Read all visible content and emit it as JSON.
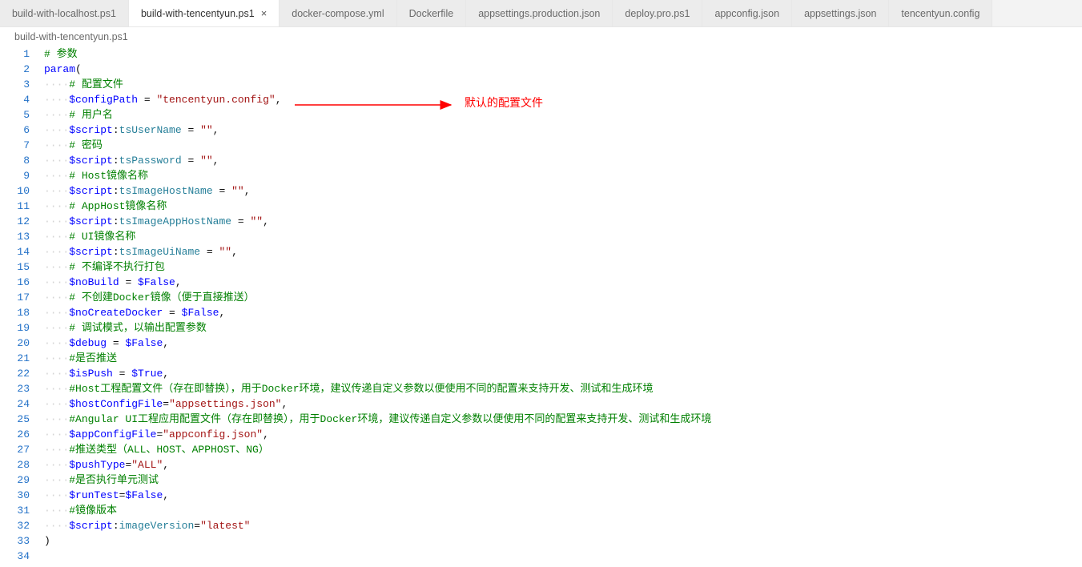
{
  "tabs": [
    {
      "label": "build-with-localhost.ps1",
      "active": false
    },
    {
      "label": "build-with-tencentyun.ps1",
      "active": true
    },
    {
      "label": "docker-compose.yml",
      "active": false
    },
    {
      "label": "Dockerfile",
      "active": false
    },
    {
      "label": "appsettings.production.json",
      "active": false
    },
    {
      "label": "deploy.pro.ps1",
      "active": false
    },
    {
      "label": "appconfig.json",
      "active": false
    },
    {
      "label": "appsettings.json",
      "active": false
    },
    {
      "label": "tencentyun.config",
      "active": false
    }
  ],
  "breadcrumb": "build-with-tencentyun.ps1",
  "annotation": "默认的配置文件",
  "close_glyph": "×",
  "lines": [
    {
      "n": 1,
      "segs": [
        {
          "t": "# 参数",
          "c": "cm-green"
        }
      ]
    },
    {
      "n": 2,
      "segs": [
        {
          "t": "param",
          "c": "cm-blue"
        },
        {
          "t": "(",
          "c": "cm-black"
        }
      ]
    },
    {
      "n": 3,
      "indent": 1,
      "segs": [
        {
          "t": "# 配置文件",
          "c": "cm-green"
        }
      ]
    },
    {
      "n": 4,
      "indent": 1,
      "segs": [
        {
          "t": "$configPath",
          "c": "cm-blue"
        },
        {
          "t": " = ",
          "c": "cm-black"
        },
        {
          "t": "\"tencentyun.config\"",
          "c": "cm-darkred"
        },
        {
          "t": ",",
          "c": "cm-black"
        }
      ]
    },
    {
      "n": 5,
      "indent": 1,
      "segs": [
        {
          "t": "# 用户名",
          "c": "cm-green"
        }
      ]
    },
    {
      "n": 6,
      "indent": 1,
      "segs": [
        {
          "t": "$script",
          "c": "cm-blue"
        },
        {
          "t": ":",
          "c": "cm-black"
        },
        {
          "t": "tsUserName",
          "c": "cm-type"
        },
        {
          "t": " = ",
          "c": "cm-black"
        },
        {
          "t": "\"\"",
          "c": "cm-darkred"
        },
        {
          "t": ",",
          "c": "cm-black"
        }
      ]
    },
    {
      "n": 7,
      "indent": 1,
      "segs": [
        {
          "t": "# 密码",
          "c": "cm-green"
        }
      ]
    },
    {
      "n": 8,
      "indent": 1,
      "segs": [
        {
          "t": "$script",
          "c": "cm-blue"
        },
        {
          "t": ":",
          "c": "cm-black"
        },
        {
          "t": "tsPassword",
          "c": "cm-type"
        },
        {
          "t": " = ",
          "c": "cm-black"
        },
        {
          "t": "\"\"",
          "c": "cm-darkred"
        },
        {
          "t": ",",
          "c": "cm-black"
        }
      ]
    },
    {
      "n": 9,
      "indent": 1,
      "segs": [
        {
          "t": "# Host镜像名称",
          "c": "cm-green"
        }
      ]
    },
    {
      "n": 10,
      "indent": 1,
      "segs": [
        {
          "t": "$script",
          "c": "cm-blue"
        },
        {
          "t": ":",
          "c": "cm-black"
        },
        {
          "t": "tsImageHostName",
          "c": "cm-type"
        },
        {
          "t": " = ",
          "c": "cm-black"
        },
        {
          "t": "\"\"",
          "c": "cm-darkred"
        },
        {
          "t": ",",
          "c": "cm-black"
        }
      ]
    },
    {
      "n": 11,
      "indent": 1,
      "segs": [
        {
          "t": "# AppHost镜像名称",
          "c": "cm-green"
        }
      ]
    },
    {
      "n": 12,
      "indent": 1,
      "segs": [
        {
          "t": "$script",
          "c": "cm-blue"
        },
        {
          "t": ":",
          "c": "cm-black"
        },
        {
          "t": "tsImageAppHostName",
          "c": "cm-type"
        },
        {
          "t": " = ",
          "c": "cm-black"
        },
        {
          "t": "\"\"",
          "c": "cm-darkred"
        },
        {
          "t": ",",
          "c": "cm-black"
        }
      ]
    },
    {
      "n": 13,
      "indent": 1,
      "segs": [
        {
          "t": "# UI镜像名称",
          "c": "cm-green"
        }
      ]
    },
    {
      "n": 14,
      "indent": 1,
      "segs": [
        {
          "t": "$script",
          "c": "cm-blue"
        },
        {
          "t": ":",
          "c": "cm-black"
        },
        {
          "t": "tsImageUiName",
          "c": "cm-type"
        },
        {
          "t": " = ",
          "c": "cm-black"
        },
        {
          "t": "\"\"",
          "c": "cm-darkred"
        },
        {
          "t": ",",
          "c": "cm-black"
        }
      ]
    },
    {
      "n": 15,
      "indent": 1,
      "segs": [
        {
          "t": "# 不编译不执行打包",
          "c": "cm-green"
        }
      ]
    },
    {
      "n": 16,
      "indent": 1,
      "segs": [
        {
          "t": "$noBuild",
          "c": "cm-blue"
        },
        {
          "t": " = ",
          "c": "cm-black"
        },
        {
          "t": "$False",
          "c": "cm-blue"
        },
        {
          "t": ",",
          "c": "cm-black"
        }
      ]
    },
    {
      "n": 17,
      "indent": 1,
      "segs": [
        {
          "t": "# 不创建Docker镜像（便于直接推送）",
          "c": "cm-green"
        }
      ]
    },
    {
      "n": 18,
      "indent": 1,
      "segs": [
        {
          "t": "$noCreateDocker",
          "c": "cm-blue"
        },
        {
          "t": " = ",
          "c": "cm-black"
        },
        {
          "t": "$False",
          "c": "cm-blue"
        },
        {
          "t": ",",
          "c": "cm-black"
        }
      ]
    },
    {
      "n": 19,
      "indent": 1,
      "segs": [
        {
          "t": "# 调试模式，以输出配置参数",
          "c": "cm-green"
        }
      ]
    },
    {
      "n": 20,
      "indent": 1,
      "segs": [
        {
          "t": "$debug",
          "c": "cm-blue"
        },
        {
          "t": " = ",
          "c": "cm-black"
        },
        {
          "t": "$False",
          "c": "cm-blue"
        },
        {
          "t": ",",
          "c": "cm-black"
        }
      ]
    },
    {
      "n": 21,
      "indent": 1,
      "segs": [
        {
          "t": "#是否推送",
          "c": "cm-green"
        }
      ]
    },
    {
      "n": 22,
      "indent": 1,
      "segs": [
        {
          "t": "$isPush",
          "c": "cm-blue"
        },
        {
          "t": " = ",
          "c": "cm-black"
        },
        {
          "t": "$True",
          "c": "cm-blue"
        },
        {
          "t": ",",
          "c": "cm-black"
        }
      ]
    },
    {
      "n": 23,
      "indent": 1,
      "segs": [
        {
          "t": "#Host工程配置文件（存在即替换），用于Docker环境，建议传递自定义参数以便使用不同的配置来支持开发、测试和生成环境",
          "c": "cm-green"
        }
      ]
    },
    {
      "n": 24,
      "indent": 1,
      "segs": [
        {
          "t": "$hostConfigFile",
          "c": "cm-blue"
        },
        {
          "t": "=",
          "c": "cm-black"
        },
        {
          "t": "\"appsettings.json\"",
          "c": "cm-darkred"
        },
        {
          "t": ",",
          "c": "cm-black"
        }
      ]
    },
    {
      "n": 25,
      "indent": 1,
      "segs": [
        {
          "t": "#Angular UI工程应用配置文件（存在即替换），用于Docker环境，建议传递自定义参数以便使用不同的配置来支持开发、测试和生成环境",
          "c": "cm-green"
        }
      ]
    },
    {
      "n": 26,
      "indent": 1,
      "segs": [
        {
          "t": "$appConfigFile",
          "c": "cm-blue"
        },
        {
          "t": "=",
          "c": "cm-black"
        },
        {
          "t": "\"appconfig.json\"",
          "c": "cm-darkred"
        },
        {
          "t": ",",
          "c": "cm-black"
        }
      ]
    },
    {
      "n": 27,
      "indent": 1,
      "segs": [
        {
          "t": "#推送类型（ALL、HOST、APPHOST、NG）",
          "c": "cm-green"
        }
      ]
    },
    {
      "n": 28,
      "indent": 1,
      "segs": [
        {
          "t": "$pushType",
          "c": "cm-blue"
        },
        {
          "t": "=",
          "c": "cm-black"
        },
        {
          "t": "\"ALL\"",
          "c": "cm-darkred"
        },
        {
          "t": ",",
          "c": "cm-black"
        }
      ]
    },
    {
      "n": 29,
      "indent": 1,
      "segs": [
        {
          "t": "#是否执行单元测试",
          "c": "cm-green"
        }
      ]
    },
    {
      "n": 30,
      "indent": 1,
      "segs": [
        {
          "t": "$runTest",
          "c": "cm-blue"
        },
        {
          "t": "=",
          "c": "cm-black"
        },
        {
          "t": "$False",
          "c": "cm-blue"
        },
        {
          "t": ",",
          "c": "cm-black"
        }
      ]
    },
    {
      "n": 31,
      "indent": 1,
      "segs": [
        {
          "t": "#镜像版本",
          "c": "cm-green"
        }
      ]
    },
    {
      "n": 32,
      "indent": 1,
      "segs": [
        {
          "t": "$script",
          "c": "cm-blue"
        },
        {
          "t": ":",
          "c": "cm-black"
        },
        {
          "t": "imageVersion",
          "c": "cm-type"
        },
        {
          "t": "=",
          "c": "cm-black"
        },
        {
          "t": "\"latest\"",
          "c": "cm-darkred"
        }
      ]
    },
    {
      "n": 33,
      "segs": [
        {
          "t": ")",
          "c": "cm-black"
        }
      ]
    },
    {
      "n": 34,
      "segs": []
    }
  ]
}
